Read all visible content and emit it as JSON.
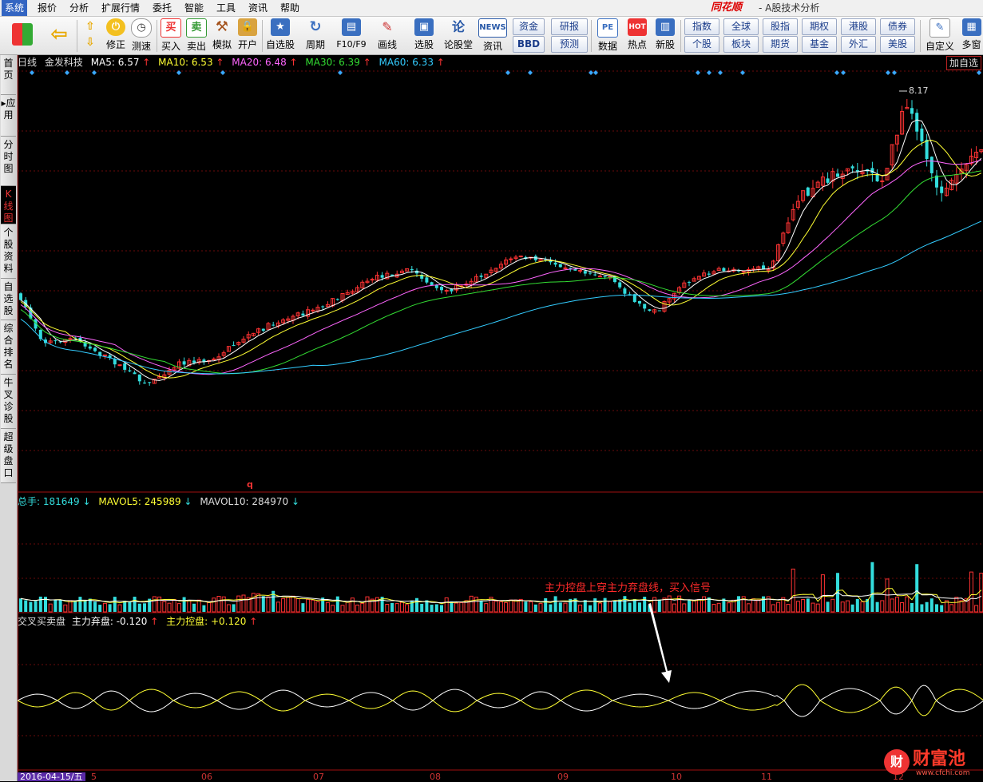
{
  "menu": [
    "系统",
    "报价",
    "分析",
    "扩展行情",
    "委托",
    "智能",
    "工具",
    "资讯",
    "帮助"
  ],
  "brand": "同花顺",
  "app_subtitle": "- A股技术分析",
  "toolbar": {
    "buttons": [
      "修正",
      "测速",
      "买入",
      "卖出",
      "模拟",
      "开户",
      "自选股",
      "周期",
      "F10/F9",
      "画线",
      "选股",
      "论股堂",
      "资讯",
      "数据",
      "热点",
      "新股",
      "自定义",
      "多窗"
    ],
    "icon_text": {
      "buy": "买",
      "sell": "卖",
      "news": "NEWS",
      "pe": "PE",
      "hot": "HOT"
    },
    "grid_left": [
      "资金",
      "BBD",
      "研报",
      "预测"
    ],
    "grid_right": [
      "指数",
      "全球",
      "股指",
      "期权",
      "港股",
      "债券",
      "个股",
      "板块",
      "期货",
      "基金",
      "外汇",
      "美股"
    ]
  },
  "left_tabs": [
    "首页",
    "应用",
    "分时图",
    "K线图",
    "个股资料",
    "自选股",
    "综合排名",
    "牛叉诊股",
    "超级盘口"
  ],
  "header": {
    "period": "日线",
    "stock": "金发科技",
    "ma5": "MA5: 6.57",
    "ma10": "MA10: 6.53",
    "ma20": "MA20: 6.48",
    "ma30": "MA30: 6.39",
    "ma60": "MA60: 6.33",
    "add_fav": "加自选"
  },
  "volume": {
    "total": "总手: 181649",
    "mavol5": "MAVOL5: 245989",
    "mavol10": "MAVOL10: 284970"
  },
  "indicator": {
    "name": "交叉买卖盘",
    "abandon": "主力弃盘: -0.120",
    "control": "主力控盘: +0.120"
  },
  "annotation": "主力控盘上穿主力弃盘线，买入信号",
  "peak_label": "8.17",
  "q_marker": "q",
  "date_badge": "2016-04-15/五",
  "x_ticks": [
    "5",
    "06",
    "07",
    "08",
    "09",
    "10",
    "11",
    "12"
  ],
  "watermark": {
    "name": "财富池",
    "url": "www.cfchi.com"
  },
  "colors": {
    "up": "#ff3333",
    "down": "#33dddd",
    "ma5": "#ffffff",
    "ma10": "#ffff33",
    "ma20": "#ff66ff",
    "ma30": "#33dd33",
    "ma60": "#33ccff"
  }
}
